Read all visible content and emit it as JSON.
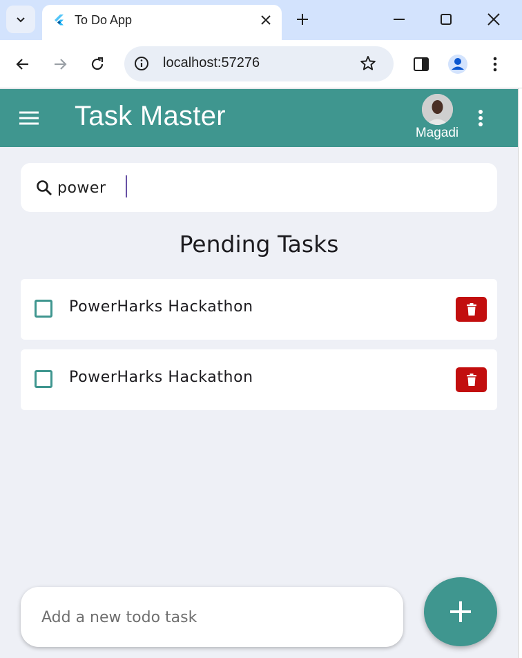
{
  "browser": {
    "tab_title": "To Do App",
    "url": "localhost:57276"
  },
  "appbar": {
    "title": "Task Master",
    "user_name": "Magadi"
  },
  "search": {
    "value": "power"
  },
  "section_title": "Pending Tasks",
  "tasks": [
    {
      "label": "PowerHarks Hackathon",
      "checked": false
    },
    {
      "label": "PowerHarks Hackathon",
      "checked": false
    }
  ],
  "add_task": {
    "placeholder": "Add a new todo task"
  },
  "colors": {
    "primary": "#3f968f",
    "delete": "#c20e0e",
    "background": "#eef0f6",
    "caret": "#6750a4"
  },
  "icons": {
    "tab_list": "chevron-down-icon",
    "favicon": "flutter-icon",
    "add_fab": "plus-icon",
    "delete": "trash-icon"
  }
}
